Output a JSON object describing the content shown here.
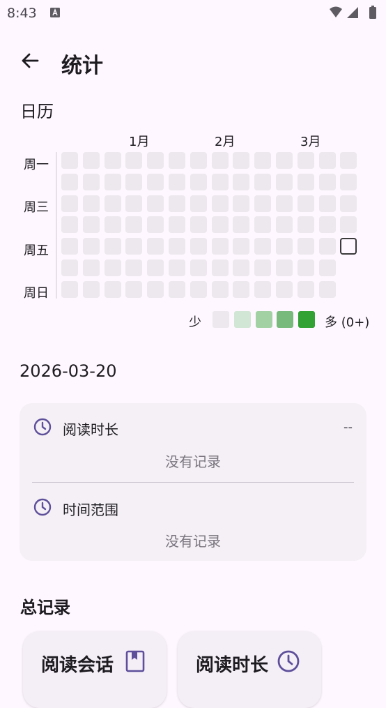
{
  "status_bar": {
    "time": "8:43"
  },
  "app_bar": {
    "title": "统计"
  },
  "calendar": {
    "section_title": "日历",
    "months": [
      "1月",
      "2月",
      "3月"
    ],
    "day_labels": [
      "周一",
      "周三",
      "周五",
      "周日"
    ],
    "legend": {
      "less": "少",
      "more": "多 (0+)",
      "colors": [
        "#EDE7EE",
        "#D2E6D5",
        "#A2D2A4",
        "#78B97C",
        "#31A233"
      ]
    },
    "empty_color": "#EDE7EE"
  },
  "selected": {
    "date": "2026-03-20",
    "reading_duration": {
      "label": "阅读时长",
      "value": "--",
      "empty": "没有记录"
    },
    "time_range": {
      "label": "时间范围",
      "empty": "没有记录"
    }
  },
  "totals": {
    "section_title": "总记录",
    "cards": [
      {
        "label": "阅读会话",
        "icon": "bookmark-book-icon"
      },
      {
        "label": "阅读时长",
        "icon": "clock-icon"
      }
    ]
  },
  "colors": {
    "accent": "#5E4F9A",
    "background": "#FEF7FF",
    "card": "#F4F0F5"
  }
}
